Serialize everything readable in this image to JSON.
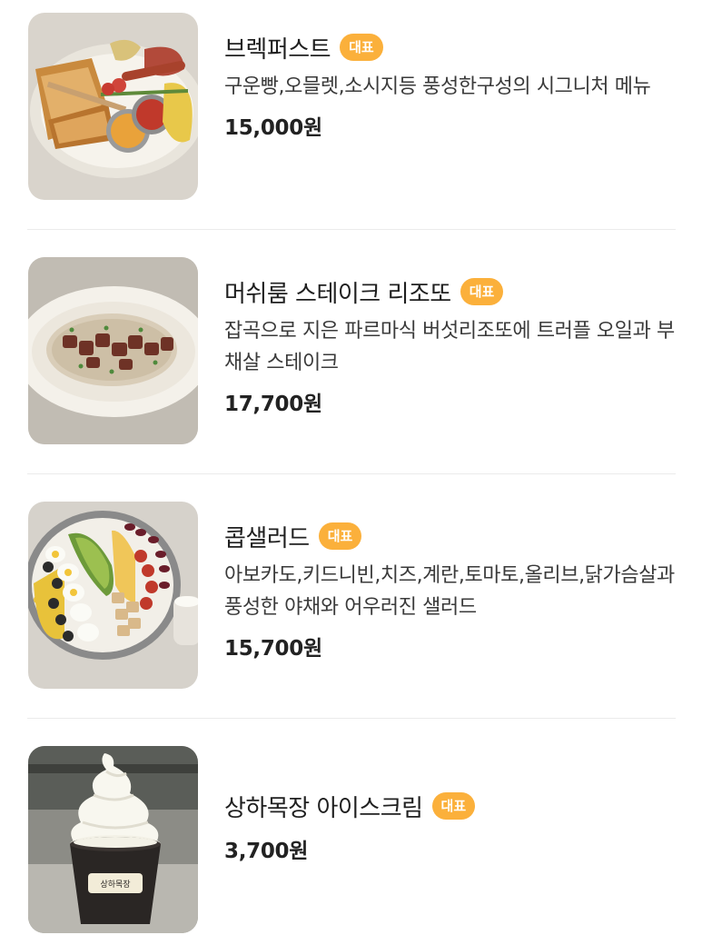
{
  "menu": {
    "items": [
      {
        "name": "브렉퍼스트",
        "badge": "대표",
        "description": "구운빵,오믈렛,소시지등 풍성한구성의 시그니처 메뉴",
        "price": "15,000원",
        "image": "breakfast-plate"
      },
      {
        "name": "머쉬룸 스테이크 리조또",
        "badge": "대표",
        "description": "잡곡으로 지은 파르마식 버섯리조또에 트러플 오일과 부채살 스테이크",
        "price": "17,700원",
        "image": "risotto-plate"
      },
      {
        "name": "콥샐러드",
        "badge": "대표",
        "description": "아보카도,키드니빈,치즈,계란,토마토,올리브,닭가슴살과 풍성한 야채와 어우러진 샐러드",
        "price": "15,700원",
        "image": "cobb-salad-bowl"
      },
      {
        "name": "상하목장 아이스크림",
        "badge": "대표",
        "description": "",
        "price": "3,700원",
        "image": "soft-serve-cup",
        "image_label": "상하목장"
      }
    ]
  },
  "colors": {
    "badge": "#fbb03b",
    "divider": "#ebebeb",
    "text": "#222222"
  }
}
